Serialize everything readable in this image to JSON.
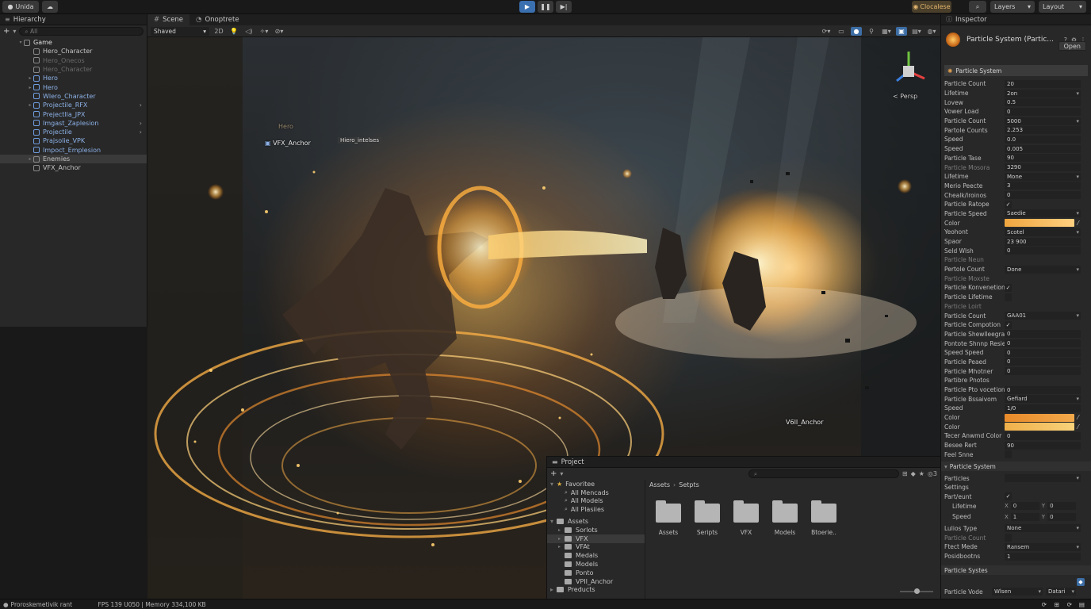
{
  "topbar": {
    "account_label": "Unida",
    "collab_icon": "cloud-icon",
    "play_icon": "play-icon",
    "pause_icon": "pause-icon",
    "step_icon": "step-icon",
    "cloud_label": "Clocalese",
    "search_icon": "search-icon",
    "layers_label": "Layers",
    "layout_label": "Layout"
  },
  "hierarchy": {
    "tab_label": "Hierarchy",
    "search_placeholder": "All",
    "items": [
      {
        "label": "Game",
        "style": "root"
      },
      {
        "label": "Hero_Character",
        "style": "normal"
      },
      {
        "label": "Hero_Onecos",
        "style": "dim"
      },
      {
        "label": "Hero_Character",
        "style": "dim"
      },
      {
        "label": "Hero",
        "style": "blue"
      },
      {
        "label": "Hero",
        "style": "blue"
      },
      {
        "label": "Wlero_Character",
        "style": "blue"
      },
      {
        "label": "Projectile_RFX",
        "style": "blue"
      },
      {
        "label": "Prejectlla_JPX",
        "style": "blue"
      },
      {
        "label": "Imgast_Zaplesion",
        "style": "blue"
      },
      {
        "label": "Projectile",
        "style": "blue"
      },
      {
        "label": "Prajsolie_VPK",
        "style": "blue"
      },
      {
        "label": "Impoct_Emplesion",
        "style": "blue"
      },
      {
        "label": "Enemies",
        "style": "selected"
      },
      {
        "label": "VFX_Anchor",
        "style": "normal"
      }
    ]
  },
  "scene": {
    "tab_scene": "Scene",
    "tab_game": "Onoptrete",
    "shading_mode": "Shaved",
    "mode_2d": "2D",
    "persp_label": "< Persp",
    "overlay_hero": "Hero",
    "overlay_vfx_anchor": "VFX_Anchor",
    "overlay_tag": "Hiero_intelses",
    "overlay_vfx_anchor_2": "V6II_Anchor"
  },
  "project": {
    "tab_label": "Project",
    "favorites_label": "Favoritee",
    "favorites": [
      "All Mencads",
      "All Models",
      "All Plasiies"
    ],
    "assets_label": "Assets",
    "assets": [
      "Sorlots",
      "VFX",
      "VFAt",
      "Medals",
      "Models",
      "Ponto",
      "VPII_Anchor"
    ],
    "products_label": "Preducts",
    "breadcrumb_root": "Assets",
    "breadcrumb_leaf": "Setpts",
    "count_badge": "3",
    "folders": [
      "Assets",
      "Seripts",
      "VFX",
      "Models",
      "Btoerie.."
    ]
  },
  "inspector": {
    "tab_label": "Inspector",
    "title": "Particle System (Partic...",
    "open_label": "Open",
    "component_label": "Particle System",
    "props": [
      {
        "label": "Particle Count",
        "value": "20",
        "kind": "field"
      },
      {
        "label": "Lifetime",
        "value": "2on",
        "kind": "dropdown"
      },
      {
        "label": "Lovew",
        "value": "0.5",
        "kind": "field"
      },
      {
        "label": "Vower Load",
        "value": "0",
        "kind": "field"
      },
      {
        "label": "Particle Count",
        "value": "5000",
        "kind": "dropdown"
      },
      {
        "label": "Partole Counts",
        "value": "2.253",
        "kind": "field"
      },
      {
        "label": "Speed",
        "value": "0.0",
        "kind": "field"
      },
      {
        "label": "Speed",
        "value": "0.005",
        "kind": "field"
      },
      {
        "label": "Particle Tase",
        "value": "90",
        "kind": "field"
      },
      {
        "label": "Particle Mosora",
        "value": "3290",
        "kind": "field",
        "dim": true
      },
      {
        "label": "Lifetime",
        "value": "Mone",
        "kind": "dropdown"
      },
      {
        "label": "Merio Peecte",
        "value": "3",
        "kind": "field"
      },
      {
        "label": "Chealk/lroinos",
        "value": "0",
        "kind": "field"
      },
      {
        "label": "Particle Ratope",
        "value": "✓",
        "kind": "check"
      },
      {
        "label": "Particle Speed",
        "value": "Saedie",
        "kind": "dropdown"
      },
      {
        "label": "Color",
        "value": "",
        "kind": "color"
      },
      {
        "label": "Yeohont",
        "value": "Scotel",
        "kind": "dropdown"
      },
      {
        "label": "Spaor",
        "value": "23 900",
        "kind": "field"
      },
      {
        "label": "Seld Wlsh",
        "value": "0",
        "kind": "field"
      },
      {
        "label": "Particle Neun",
        "value": "",
        "kind": "none",
        "dim": true
      },
      {
        "label": "Pertole Count",
        "value": "Done",
        "kind": "dropdown"
      },
      {
        "label": "Particle Moxste",
        "value": "",
        "kind": "none",
        "dim": true
      },
      {
        "label": "Particle Konvenetion",
        "value": "✓",
        "kind": "check"
      },
      {
        "label": "Particle Lifetime",
        "value": "",
        "kind": "check"
      },
      {
        "label": "Particle Loirt",
        "value": "",
        "kind": "none",
        "dim": true
      },
      {
        "label": "Particle Count",
        "value": "GAA01",
        "kind": "dropdown"
      },
      {
        "label": "Particle Compotion",
        "value": "✓",
        "kind": "check"
      },
      {
        "label": "Particle Shewlleegra",
        "value": "0",
        "kind": "field"
      },
      {
        "label": "Pontote Shnnp Resie",
        "value": "0",
        "kind": "field"
      },
      {
        "label": "Speed Speed",
        "value": "0",
        "kind": "field"
      },
      {
        "label": "Particle Peaed",
        "value": "0",
        "kind": "field"
      },
      {
        "label": "Particle Mhotner",
        "value": "0",
        "kind": "field"
      },
      {
        "label": "Partibre Pnotos",
        "value": "",
        "kind": "none"
      },
      {
        "label": "Particle Pto vocetion",
        "value": "0",
        "kind": "field"
      },
      {
        "label": "Particle Bssaivom",
        "value": "Gefiard",
        "kind": "dropdown"
      },
      {
        "label": "Speed",
        "value": "1/0",
        "kind": "field"
      },
      {
        "label": "Color",
        "value": "",
        "kind": "color2"
      },
      {
        "label": "Color",
        "value": "",
        "kind": "color3"
      },
      {
        "label": "Tecer Anwmd Color",
        "value": "0",
        "kind": "field"
      },
      {
        "label": "Besee Rert",
        "value": "90",
        "kind": "field"
      },
      {
        "label": "Feel Snne",
        "value": "",
        "kind": "check"
      }
    ],
    "section2_label": "Particle System",
    "props2": [
      {
        "label": "Particles",
        "value": "",
        "kind": "dropdown"
      },
      {
        "label": "Settings",
        "value": "",
        "kind": "none"
      },
      {
        "label": "Part/eunt",
        "value": "✓",
        "kind": "check"
      }
    ],
    "lifetime_label": "Lifetime",
    "lifetime_x": "0",
    "lifetime_y": "0",
    "speed_label": "Speed",
    "speed_x": "1",
    "speed_y": "0",
    "props3": [
      {
        "label": "Lulios Type",
        "value": "None",
        "kind": "dropdown"
      },
      {
        "label": "Particle Count",
        "value": "",
        "kind": "check",
        "dim": true
      },
      {
        "label": "Ftect Mede",
        "value": "Ransem",
        "kind": "dropdown"
      },
      {
        "label": "Posidbootns",
        "value": "1",
        "kind": "field"
      }
    ],
    "section3_label": "Particle Systes",
    "mode_label": "Particle Vode",
    "mode_value": "Wlsen",
    "mode_value2": "Datari"
  },
  "status": {
    "message": "Proroskemetivik rant",
    "stats": "FPS 139 U050 | Memory 334,100 KB"
  }
}
